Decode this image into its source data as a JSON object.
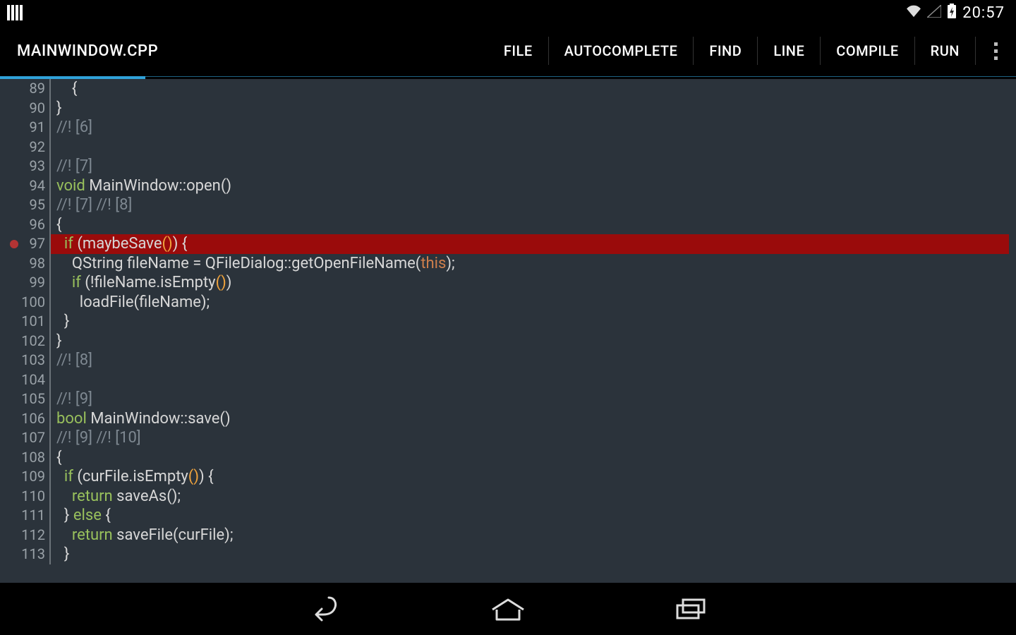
{
  "status": {
    "time": "20:57"
  },
  "toolbar": {
    "title": "MAINWINDOW.CPP",
    "menu": [
      "FILE",
      "AUTOCOMPLETE",
      "FIND",
      "LINE",
      "COMPILE",
      "RUN"
    ],
    "indicatorWidth": 206
  },
  "editor": {
    "firstLine": 89,
    "breakpointLine": 97,
    "highlightLine": 97,
    "lines": [
      {
        "n": 89,
        "t": [
          [
            "txt",
            "    {"
          ]
        ]
      },
      {
        "n": 90,
        "t": [
          [
            "txt",
            "}"
          ]
        ]
      },
      {
        "n": 91,
        "t": [
          [
            "cmt",
            "//! [6]"
          ]
        ]
      },
      {
        "n": 92,
        "t": [
          [
            "txt",
            ""
          ]
        ]
      },
      {
        "n": 93,
        "t": [
          [
            "cmt",
            "//! [7]"
          ]
        ]
      },
      {
        "n": 94,
        "t": [
          [
            "kw",
            "void"
          ],
          [
            "txt",
            " MainWindow::open()"
          ]
        ]
      },
      {
        "n": 95,
        "t": [
          [
            "cmt",
            "//! [7] //! [8]"
          ]
        ]
      },
      {
        "n": 96,
        "t": [
          [
            "txt",
            "{"
          ]
        ]
      },
      {
        "n": 97,
        "t": [
          [
            "txt",
            "  "
          ],
          [
            "kw",
            "if"
          ],
          [
            "txt",
            " (maybeSave"
          ],
          [
            "pn",
            "()"
          ],
          [
            "txt",
            ") {"
          ]
        ]
      },
      {
        "n": 98,
        "t": [
          [
            "txt",
            "    QString fileName = QFileDialog::getOpenFileName("
          ],
          [
            "this",
            "this"
          ],
          [
            "txt",
            ");"
          ]
        ]
      },
      {
        "n": 99,
        "t": [
          [
            "txt",
            "    "
          ],
          [
            "kw",
            "if"
          ],
          [
            "txt",
            " (!fileName.isEmpty"
          ],
          [
            "pn",
            "()"
          ],
          [
            "txt",
            ")"
          ]
        ]
      },
      {
        "n": 100,
        "t": [
          [
            "txt",
            "      loadFile(fileName);"
          ]
        ]
      },
      {
        "n": 101,
        "t": [
          [
            "txt",
            "  }"
          ]
        ]
      },
      {
        "n": 102,
        "t": [
          [
            "txt",
            "}"
          ]
        ]
      },
      {
        "n": 103,
        "t": [
          [
            "cmt",
            "//! [8]"
          ]
        ]
      },
      {
        "n": 104,
        "t": [
          [
            "txt",
            ""
          ]
        ]
      },
      {
        "n": 105,
        "t": [
          [
            "cmt",
            "//! [9]"
          ]
        ]
      },
      {
        "n": 106,
        "t": [
          [
            "kw",
            "bool"
          ],
          [
            "txt",
            " MainWindow::save()"
          ]
        ]
      },
      {
        "n": 107,
        "t": [
          [
            "cmt",
            "//! [9] //! [10]"
          ]
        ]
      },
      {
        "n": 108,
        "t": [
          [
            "txt",
            "{"
          ]
        ]
      },
      {
        "n": 109,
        "t": [
          [
            "txt",
            "  "
          ],
          [
            "kw",
            "if"
          ],
          [
            "txt",
            " (curFile.isEmpty"
          ],
          [
            "pn",
            "()"
          ],
          [
            "txt",
            ") {"
          ]
        ]
      },
      {
        "n": 110,
        "t": [
          [
            "txt",
            "    "
          ],
          [
            "kw",
            "return"
          ],
          [
            "txt",
            " saveAs();"
          ]
        ]
      },
      {
        "n": 111,
        "t": [
          [
            "txt",
            "  } "
          ],
          [
            "kw",
            "else"
          ],
          [
            "txt",
            " {"
          ]
        ]
      },
      {
        "n": 112,
        "t": [
          [
            "txt",
            "    "
          ],
          [
            "kw",
            "return"
          ],
          [
            "txt",
            " saveFile(curFile);"
          ]
        ]
      },
      {
        "n": 113,
        "t": [
          [
            "txt",
            "  }"
          ]
        ]
      }
    ]
  }
}
